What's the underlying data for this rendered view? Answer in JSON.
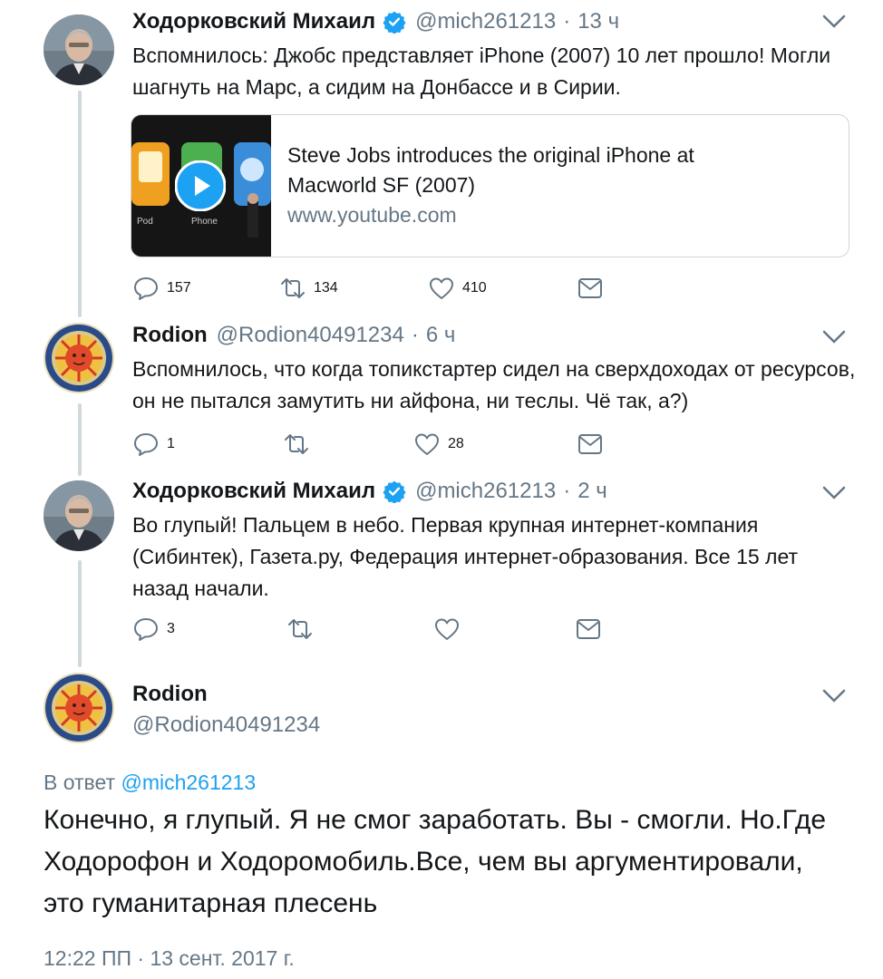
{
  "tweets": [
    {
      "name": "Ходорковский Михаил",
      "verified": true,
      "handle": "@mich261213",
      "separator": "·",
      "time": "13 ч",
      "text": "Вспомнилось: Джобс представляет iPhone (2007) 10 лет прошло! Могли шагнуть на Марс, а сидим на Донбассе и в Сирии.",
      "card": {
        "title": "Steve Jobs introduces the original iPhone at Macworld SF (2007)",
        "domain": "www.youtube.com",
        "thumb_labels": [
          "Pod",
          "Phone"
        ]
      },
      "replies": "157",
      "retweets": "134",
      "likes": "410"
    },
    {
      "name": "Rodion",
      "verified": false,
      "handle": "@Rodion40491234",
      "separator": "·",
      "time": "6 ч",
      "text": "Вспомнилось, что когда топикстартер сидел на сверхдоходах от ресурсов, он не пытался замутить ни айфона, ни теслы. Чё так, а?)",
      "replies": "1",
      "retweets": "",
      "likes": "28"
    },
    {
      "name": "Ходорковский Михаил",
      "verified": true,
      "handle": "@mich261213",
      "separator": "·",
      "time": "2 ч",
      "text": "Во глупый! Пальцем в небо. Первая крупная интернет-компания (Сибинтек), Газета.ру, Федерация интернет-образования. Все 15 лет назад начали.",
      "replies": "3",
      "retweets": "",
      "likes": ""
    }
  ],
  "main_tweet": {
    "name": "Rodion",
    "handle": "@Rodion40491234",
    "reply_prefix": "В ответ",
    "reply_handle": "@mich261213",
    "text": "Конечно, я глупый. Я не смог заработать. Вы - смогли. Но.Где Ходорофон и Ходоромобиль.Все, чем вы аргументировали, это гуманитарная плесень",
    "timestamp": "12:22 ПП · 13 сент. 2017 г."
  },
  "icons": {
    "reply": "reply-icon",
    "retweet": "retweet-icon",
    "like": "heart-icon",
    "dm": "envelope-icon",
    "verified": "verified-badge-icon",
    "menu": "chevron-down-icon",
    "play": "play-icon"
  },
  "colors": {
    "text": "#14171a",
    "secondary": "#657786",
    "accent": "#1da1f2",
    "thread_line": "#cfd9de"
  }
}
